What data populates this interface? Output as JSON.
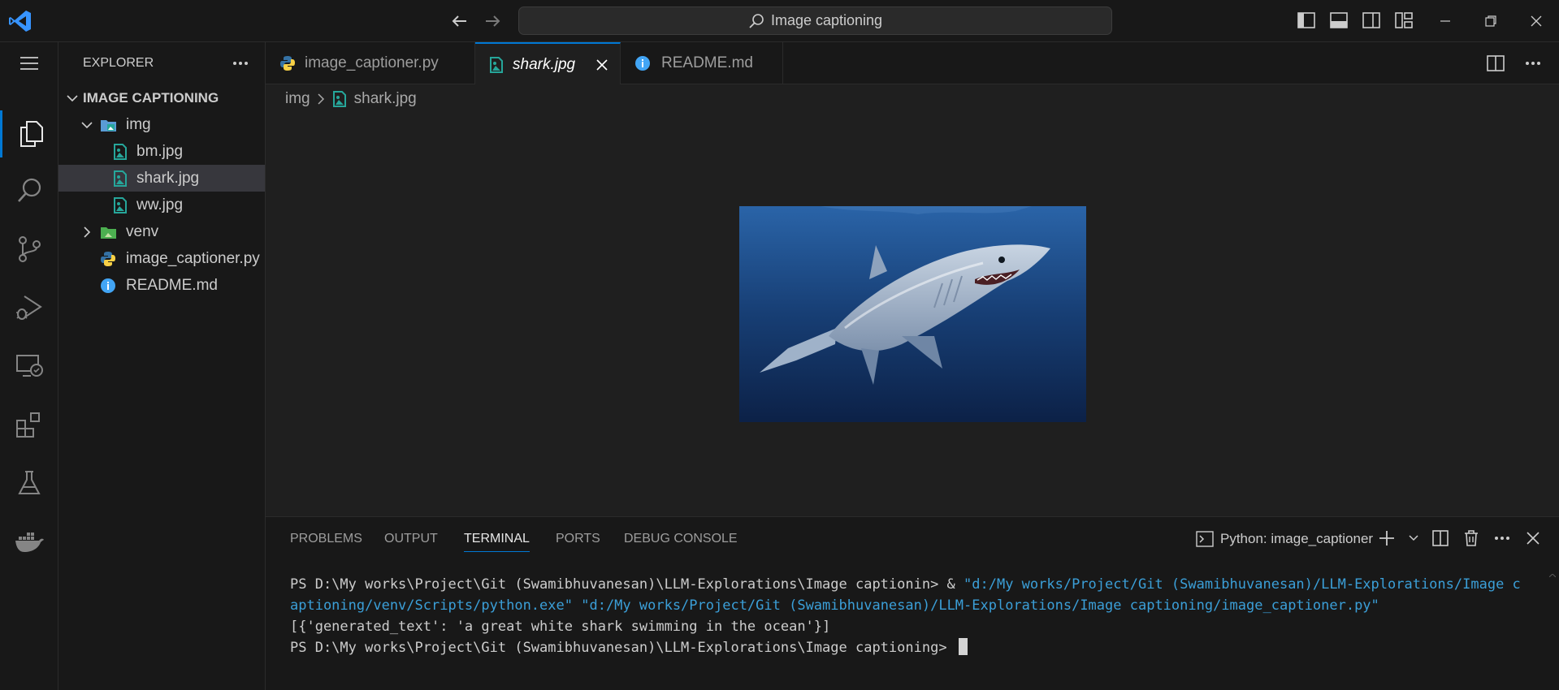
{
  "titlebar": {
    "search_text": "Image captioning"
  },
  "sidebar": {
    "title": "EXPLORER",
    "tree": [
      {
        "label": "IMAGE CAPTIONING",
        "kind": "root"
      },
      {
        "label": "img",
        "kind": "folder-open"
      },
      {
        "label": "bm.jpg",
        "kind": "image"
      },
      {
        "label": "shark.jpg",
        "kind": "image"
      },
      {
        "label": "ww.jpg",
        "kind": "image"
      },
      {
        "label": "venv",
        "kind": "folder-closed"
      },
      {
        "label": "image_captioner.py",
        "kind": "python"
      },
      {
        "label": "README.md",
        "kind": "info"
      }
    ]
  },
  "tabs": [
    {
      "label": "image_captioner.py",
      "icon": "python-icon"
    },
    {
      "label": "shark.jpg",
      "icon": "image-file-icon",
      "active": true
    },
    {
      "label": "README.md",
      "icon": "info-icon"
    }
  ],
  "breadcrumb": [
    "img",
    "shark.jpg"
  ],
  "panel": {
    "tabs": [
      "PROBLEMS",
      "OUTPUT",
      "TERMINAL",
      "PORTS",
      "DEBUG CONSOLE"
    ],
    "active_tab": "TERMINAL",
    "terminal_name": "Python: image_captioner"
  },
  "terminal": {
    "prompt1": "PS D:\\My works\\Project\\Git (Swamibhuvanesan)\\LLM-Explorations\\Image captionin> & ",
    "cmd_python": "\"d:/My works/Project/Git (Swamibhuvanesan)/LLM-Explorations/Image captioning/venv/Scripts/python.exe\"",
    "cmd_script": " \"d:/My works/Project/Git (Swamibhuvanesan)/LLM-Explorations/Image captioning/image_captioner.py\"",
    "output": "[{'generated_text': 'a great white shark swimming in the ocean'}]",
    "prompt2": "PS D:\\My works\\Project\\Git (Swamibhuvanesan)\\LLM-Explorations\\Image captioning> "
  },
  "colors": {
    "accent": "#0078d4",
    "terminal_string": "#3b9fd8",
    "image_icon": "#26a69a",
    "python_blue": "#3572a5",
    "python_yellow": "#f7d046"
  }
}
